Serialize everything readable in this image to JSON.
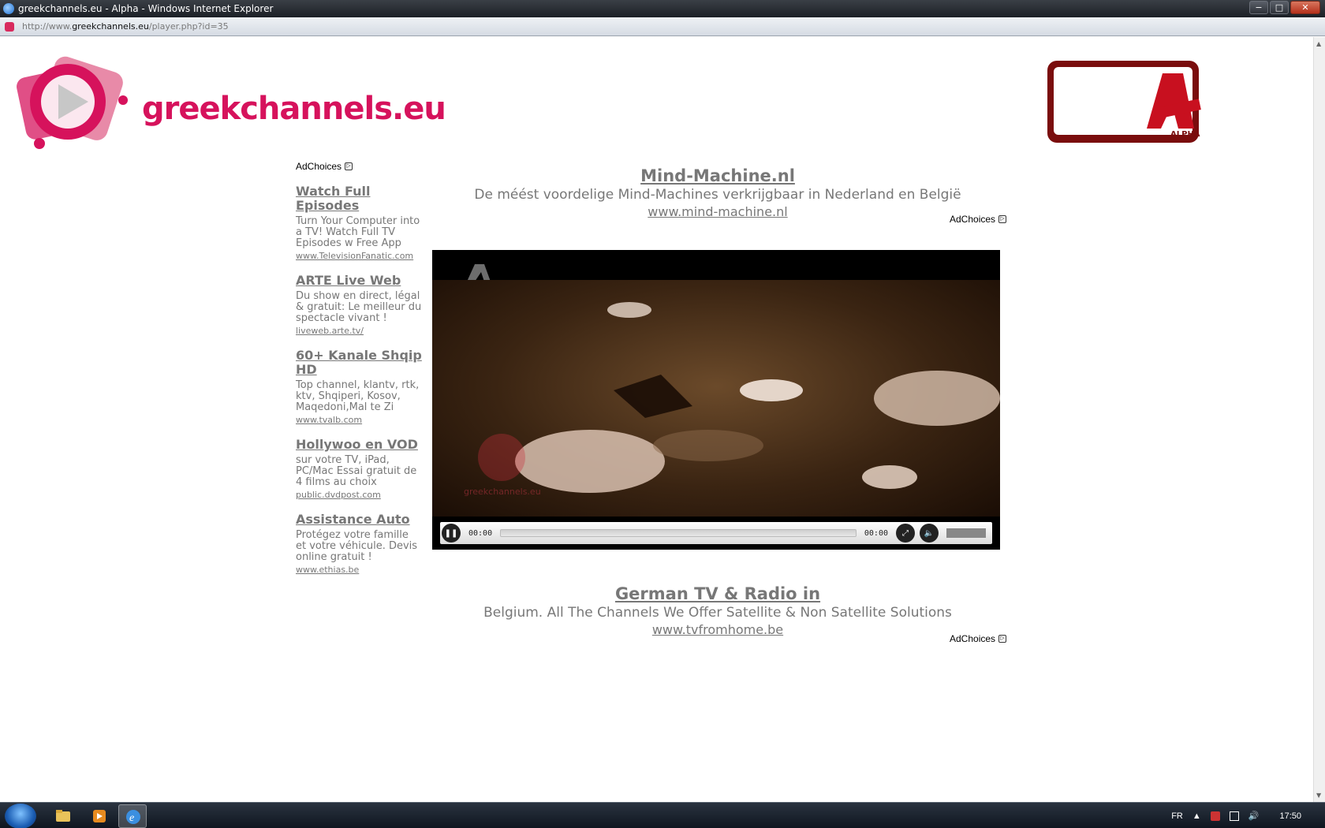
{
  "window": {
    "title": "greekchannels.eu - Alpha - Windows Internet Explorer",
    "url_prefix": "http://www.",
    "url_domain": "greekchannels.eu",
    "url_path": "/player.php?id=35",
    "min_glyph": "−",
    "max_glyph": "□",
    "close_glyph": "✕"
  },
  "header": {
    "logo_text": "greekchannels.eu",
    "channel_logo_label": "ALPHA"
  },
  "left_ads": {
    "adchoices": "AdChoices",
    "items": [
      {
        "title": "Watch Full Episodes",
        "desc": "Turn Your Computer into a TV! Watch Full TV Episodes w Free App",
        "url": "www.TelevisionFanatic.com"
      },
      {
        "title": "ARTE Live Web",
        "desc": "Du show en direct, légal & gratuit: Le meilleur du spectacle vivant !",
        "url": "liveweb.arte.tv/"
      },
      {
        "title": "60+ Kanale Shqip HD",
        "desc": "Top channel, klantv, rtk, ktv, Shqiperi, Kosov, Maqedoni,Mal te Zi",
        "url": "www.tvalb.com"
      },
      {
        "title": "Hollywoo en VOD",
        "desc": "sur votre TV, iPad, PC/Mac Essai gratuit de 4 films au choix",
        "url": "public.dvdpost.com"
      },
      {
        "title": "Assistance Auto",
        "desc": "Protégez votre famille et votre véhicule. Devis online gratuit !",
        "url": "www.ethias.be"
      }
    ]
  },
  "top_ad": {
    "title": "Mind-Machine.nl",
    "desc": "De méést voordelige Mind-Machines verkrijgbaar in Nederland en België",
    "url": "www.mind-machine.nl",
    "adchoices": "AdChoices"
  },
  "bottom_ad": {
    "title": "German TV & Radio in",
    "desc": "Belgium. All The Channels We Offer Satellite & Non Satellite Solutions",
    "url": "www.tvfromhome.be",
    "adchoices": "AdChoices"
  },
  "player": {
    "current_time": "00:00",
    "duration": "00:00",
    "progress": 0,
    "watermark": "greekchannels.eu"
  },
  "taskbar": {
    "language": "FR",
    "clock": "17:50"
  },
  "colors": {
    "brand": "#d6125c",
    "ad_text": "#777777"
  }
}
